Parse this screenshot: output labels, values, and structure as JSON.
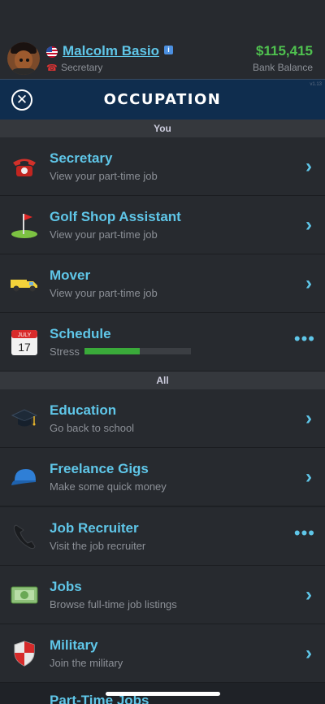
{
  "header": {
    "name": "Malcolm Basio",
    "job": "Secretary",
    "money": "$115,415",
    "money_label": "Bank Balance",
    "info_glyph": "i",
    "version": "v1.13"
  },
  "titlebar": {
    "title": "OCCUPATION",
    "close_glyph": "✕"
  },
  "sections": {
    "you": "You",
    "all": "All"
  },
  "you_items": [
    {
      "label": "Secretary",
      "sub": "View your part-time job",
      "icon": "telephone-icon"
    },
    {
      "label": "Golf Shop Assistant",
      "sub": "View your part-time job",
      "icon": "golf-flag-icon"
    },
    {
      "label": "Mover",
      "sub": "View your part-time job",
      "icon": "truck-icon"
    },
    {
      "label": "Schedule",
      "sub": "Stress",
      "icon": "calendar-icon",
      "calendar_month": "JULY",
      "calendar_day": "17",
      "stress_fraction": 0.52
    }
  ],
  "all_items": [
    {
      "label": "Education",
      "sub": "Go back to school",
      "icon": "graduation-cap-icon"
    },
    {
      "label": "Freelance Gigs",
      "sub": "Make some quick money",
      "icon": "cap-icon"
    },
    {
      "label": "Job Recruiter",
      "sub": "Visit the job recruiter",
      "icon": "phone-receiver-icon"
    },
    {
      "label": "Jobs",
      "sub": "Browse full-time job listings",
      "icon": "money-icon"
    },
    {
      "label": "Military",
      "sub": "Join the military",
      "icon": "shield-icon"
    },
    {
      "label": "Part-Time Jobs"
    }
  ],
  "glyphs": {
    "chevron": "›",
    "more": "•••"
  },
  "colors": {
    "accent": "#5fc6e8",
    "money": "#4fc14f",
    "titlebar": "#0f2d4e",
    "stress": "#3aaa3a"
  }
}
